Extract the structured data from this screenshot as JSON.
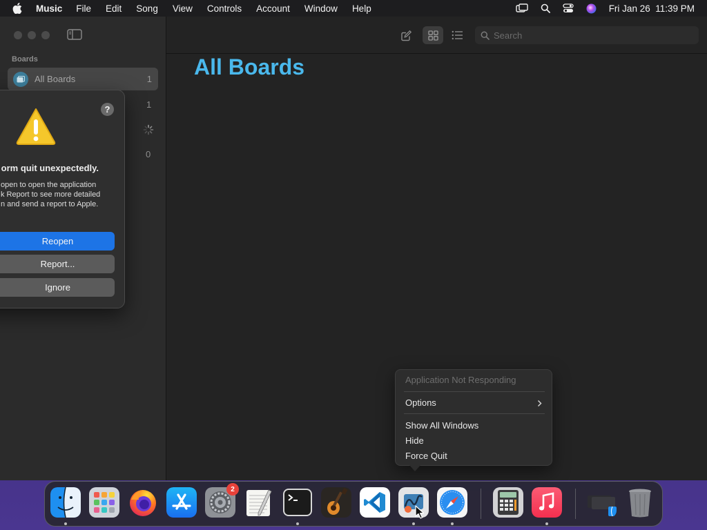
{
  "menubar": {
    "app_name": "Music",
    "items": [
      "File",
      "Edit",
      "Song",
      "View",
      "Controls",
      "Account",
      "Window",
      "Help"
    ],
    "clock": "Fri Jan 26  11:39 PM"
  },
  "sidebar": {
    "heading": "Boards",
    "rows": [
      {
        "label": "All Boards",
        "count": "1"
      },
      {
        "count": "1"
      },
      {
        "count": "0"
      }
    ]
  },
  "toolbar": {
    "search_placeholder": "Search"
  },
  "main": {
    "title": "All Boards"
  },
  "dialog": {
    "title_visible": "orm quit unexpectedly.",
    "body_lines": [
      "open to open the application",
      "k Report to see more detailed",
      "n and send a report to Apple."
    ],
    "help": "?",
    "buttons": {
      "reopen": "Reopen",
      "report": "Report...",
      "ignore": "Ignore"
    }
  },
  "context_menu": {
    "status": "Application Not Responding",
    "options": "Options",
    "show_all_windows": "Show All Windows",
    "hide": "Hide",
    "force_quit": "Force Quit"
  },
  "dock": {
    "apps": [
      "finder",
      "launchpad",
      "firefox",
      "app-store",
      "system-settings",
      "textedit",
      "terminal",
      "garageband",
      "vscode",
      "freeform",
      "safari",
      "calculator",
      "music",
      "downloads",
      "trash"
    ],
    "settings_badge": "2"
  },
  "colors": {
    "accent_title": "#4ab8ec",
    "primary_button": "#1d74e6",
    "badge": "#e8413a"
  }
}
